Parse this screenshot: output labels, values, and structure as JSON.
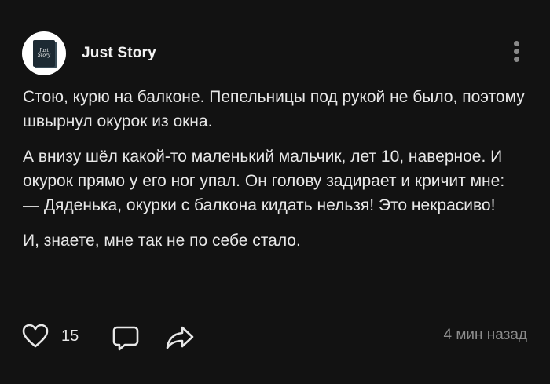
{
  "post": {
    "author": {
      "name": "Just Story",
      "avatar_text": [
        "Just",
        "Story"
      ],
      "avatar_icon": "book-icon"
    },
    "menu_icon": "more-vertical-icon",
    "paragraphs": [
      "Стою, курю на балконе. Пепельницы под рукой не было, поэтому швырнул окурок из окна.",
      "А внизу шёл какой-то маленький мальчик, лет 10, наверное. И окурок прямо у его ног упал. Он голову задирает и кричит мне:",
      "— Дяденька, окурки с балкона кидать нельзя! Это некрасиво!",
      "И, знаете, мне так не по себе стало."
    ],
    "footer": {
      "like_icon": "heart-icon",
      "like_count": "15",
      "comment_icon": "comment-icon",
      "share_icon": "share-icon",
      "timestamp": "4 мин назад"
    }
  },
  "colors": {
    "background": "#121212",
    "text": "#e8e8e8",
    "muted": "#8c8c8c"
  }
}
